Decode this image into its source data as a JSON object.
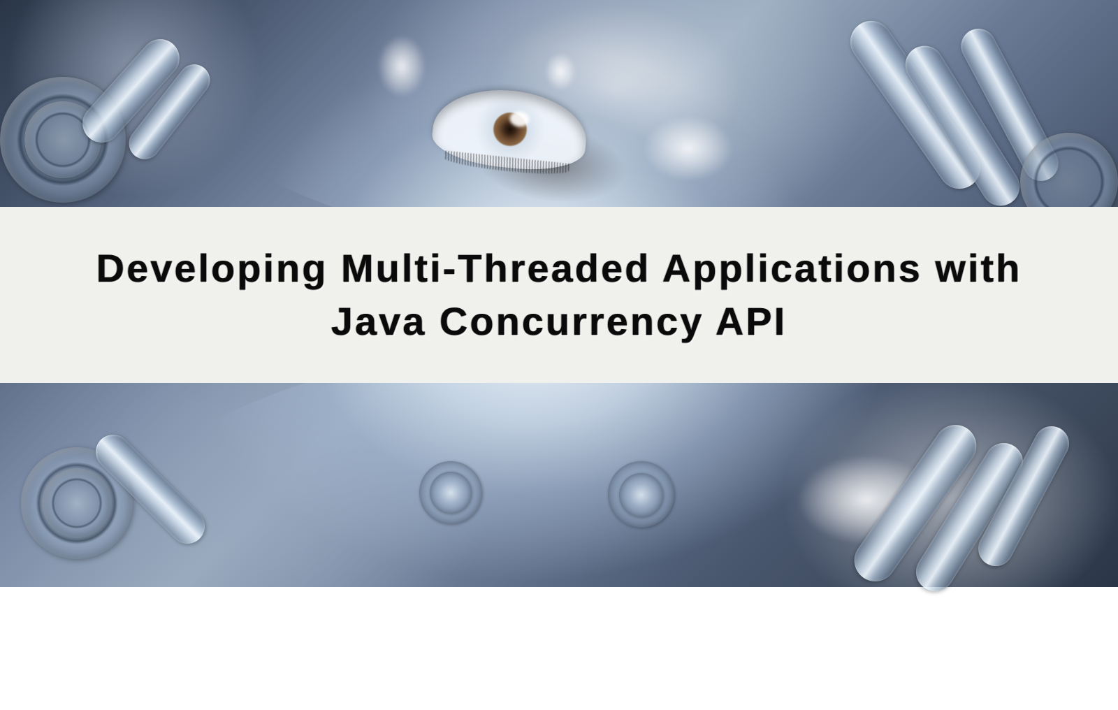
{
  "title": {
    "line1": "Developing Multi-Threaded Applications with",
    "line2": "Java Concurrency API"
  }
}
